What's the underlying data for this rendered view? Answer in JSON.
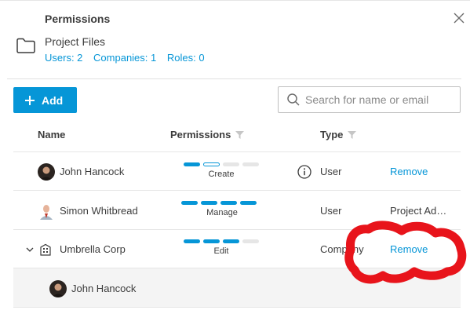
{
  "dialog": {
    "title": "Permissions",
    "folder_name": "Project Files",
    "counts": {
      "users": "Users: 2",
      "companies": "Companies: 1",
      "roles": "Roles: 0"
    }
  },
  "toolbar": {
    "add_label": "Add",
    "search_placeholder": "Search for name or email"
  },
  "columns": {
    "name": "Name",
    "permissions": "Permissions",
    "type": "Type"
  },
  "rows": [
    {
      "name": "John Hancock",
      "permission": "Create",
      "permission_level": 2,
      "type": "User",
      "action": "Remove"
    },
    {
      "name": "Simon Whitbread",
      "permission": "Manage",
      "permission_level": 4,
      "type": "User",
      "action": "Project Ad…"
    },
    {
      "name": "Umbrella Corp",
      "permission": "Edit",
      "permission_level": 3,
      "type": "Company",
      "action": "Remove"
    },
    {
      "name": "John Hancock"
    }
  ],
  "colors": {
    "accent": "#0696d7",
    "annotation": "#e8141b",
    "child_row_bg": "#f4f4f4"
  },
  "icons": [
    "close-icon",
    "folder-icon",
    "plus-icon",
    "search-icon",
    "filter-icon",
    "info-icon",
    "chevron-down-icon",
    "building-icon"
  ]
}
